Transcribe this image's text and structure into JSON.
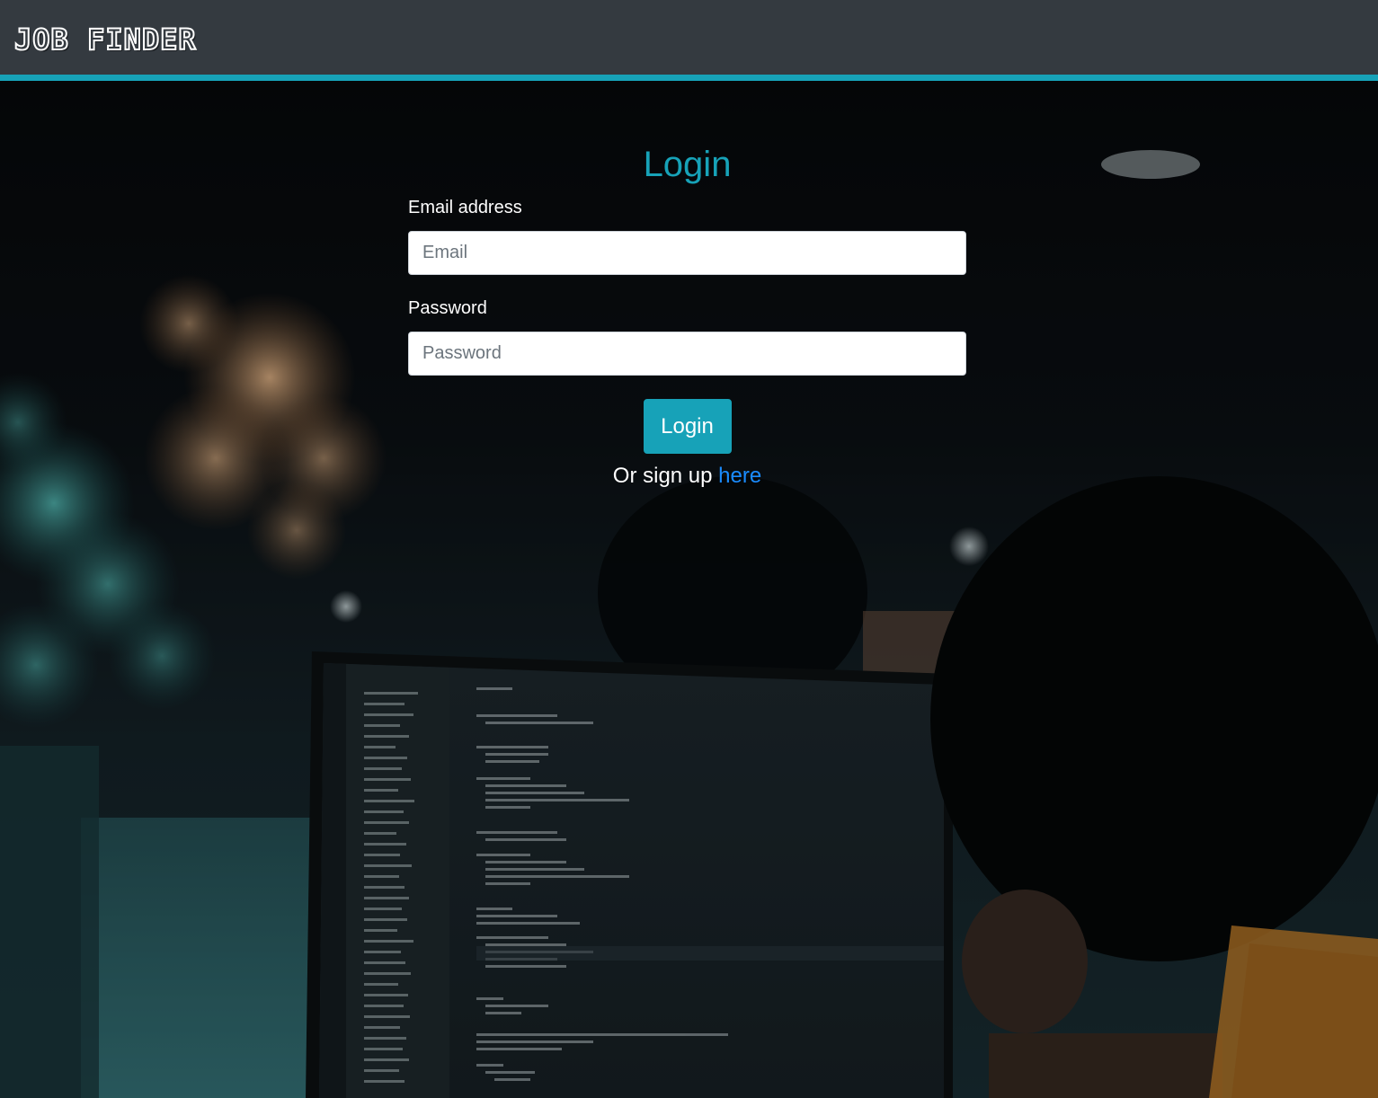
{
  "navbar": {
    "brand": "JOB FINDER",
    "accent_color": "#17a2b8",
    "background_color": "#343a40"
  },
  "login": {
    "title": "Login",
    "email_label": "Email address",
    "email_placeholder": "Email",
    "password_label": "Password",
    "password_placeholder": "Password",
    "submit_label": "Login",
    "signup_prefix": "Or sign up",
    "signup_link": "here",
    "title_color": "#17a2b8",
    "link_color": "#1a8cff"
  },
  "background": {
    "icon": "office-coding-photo"
  }
}
